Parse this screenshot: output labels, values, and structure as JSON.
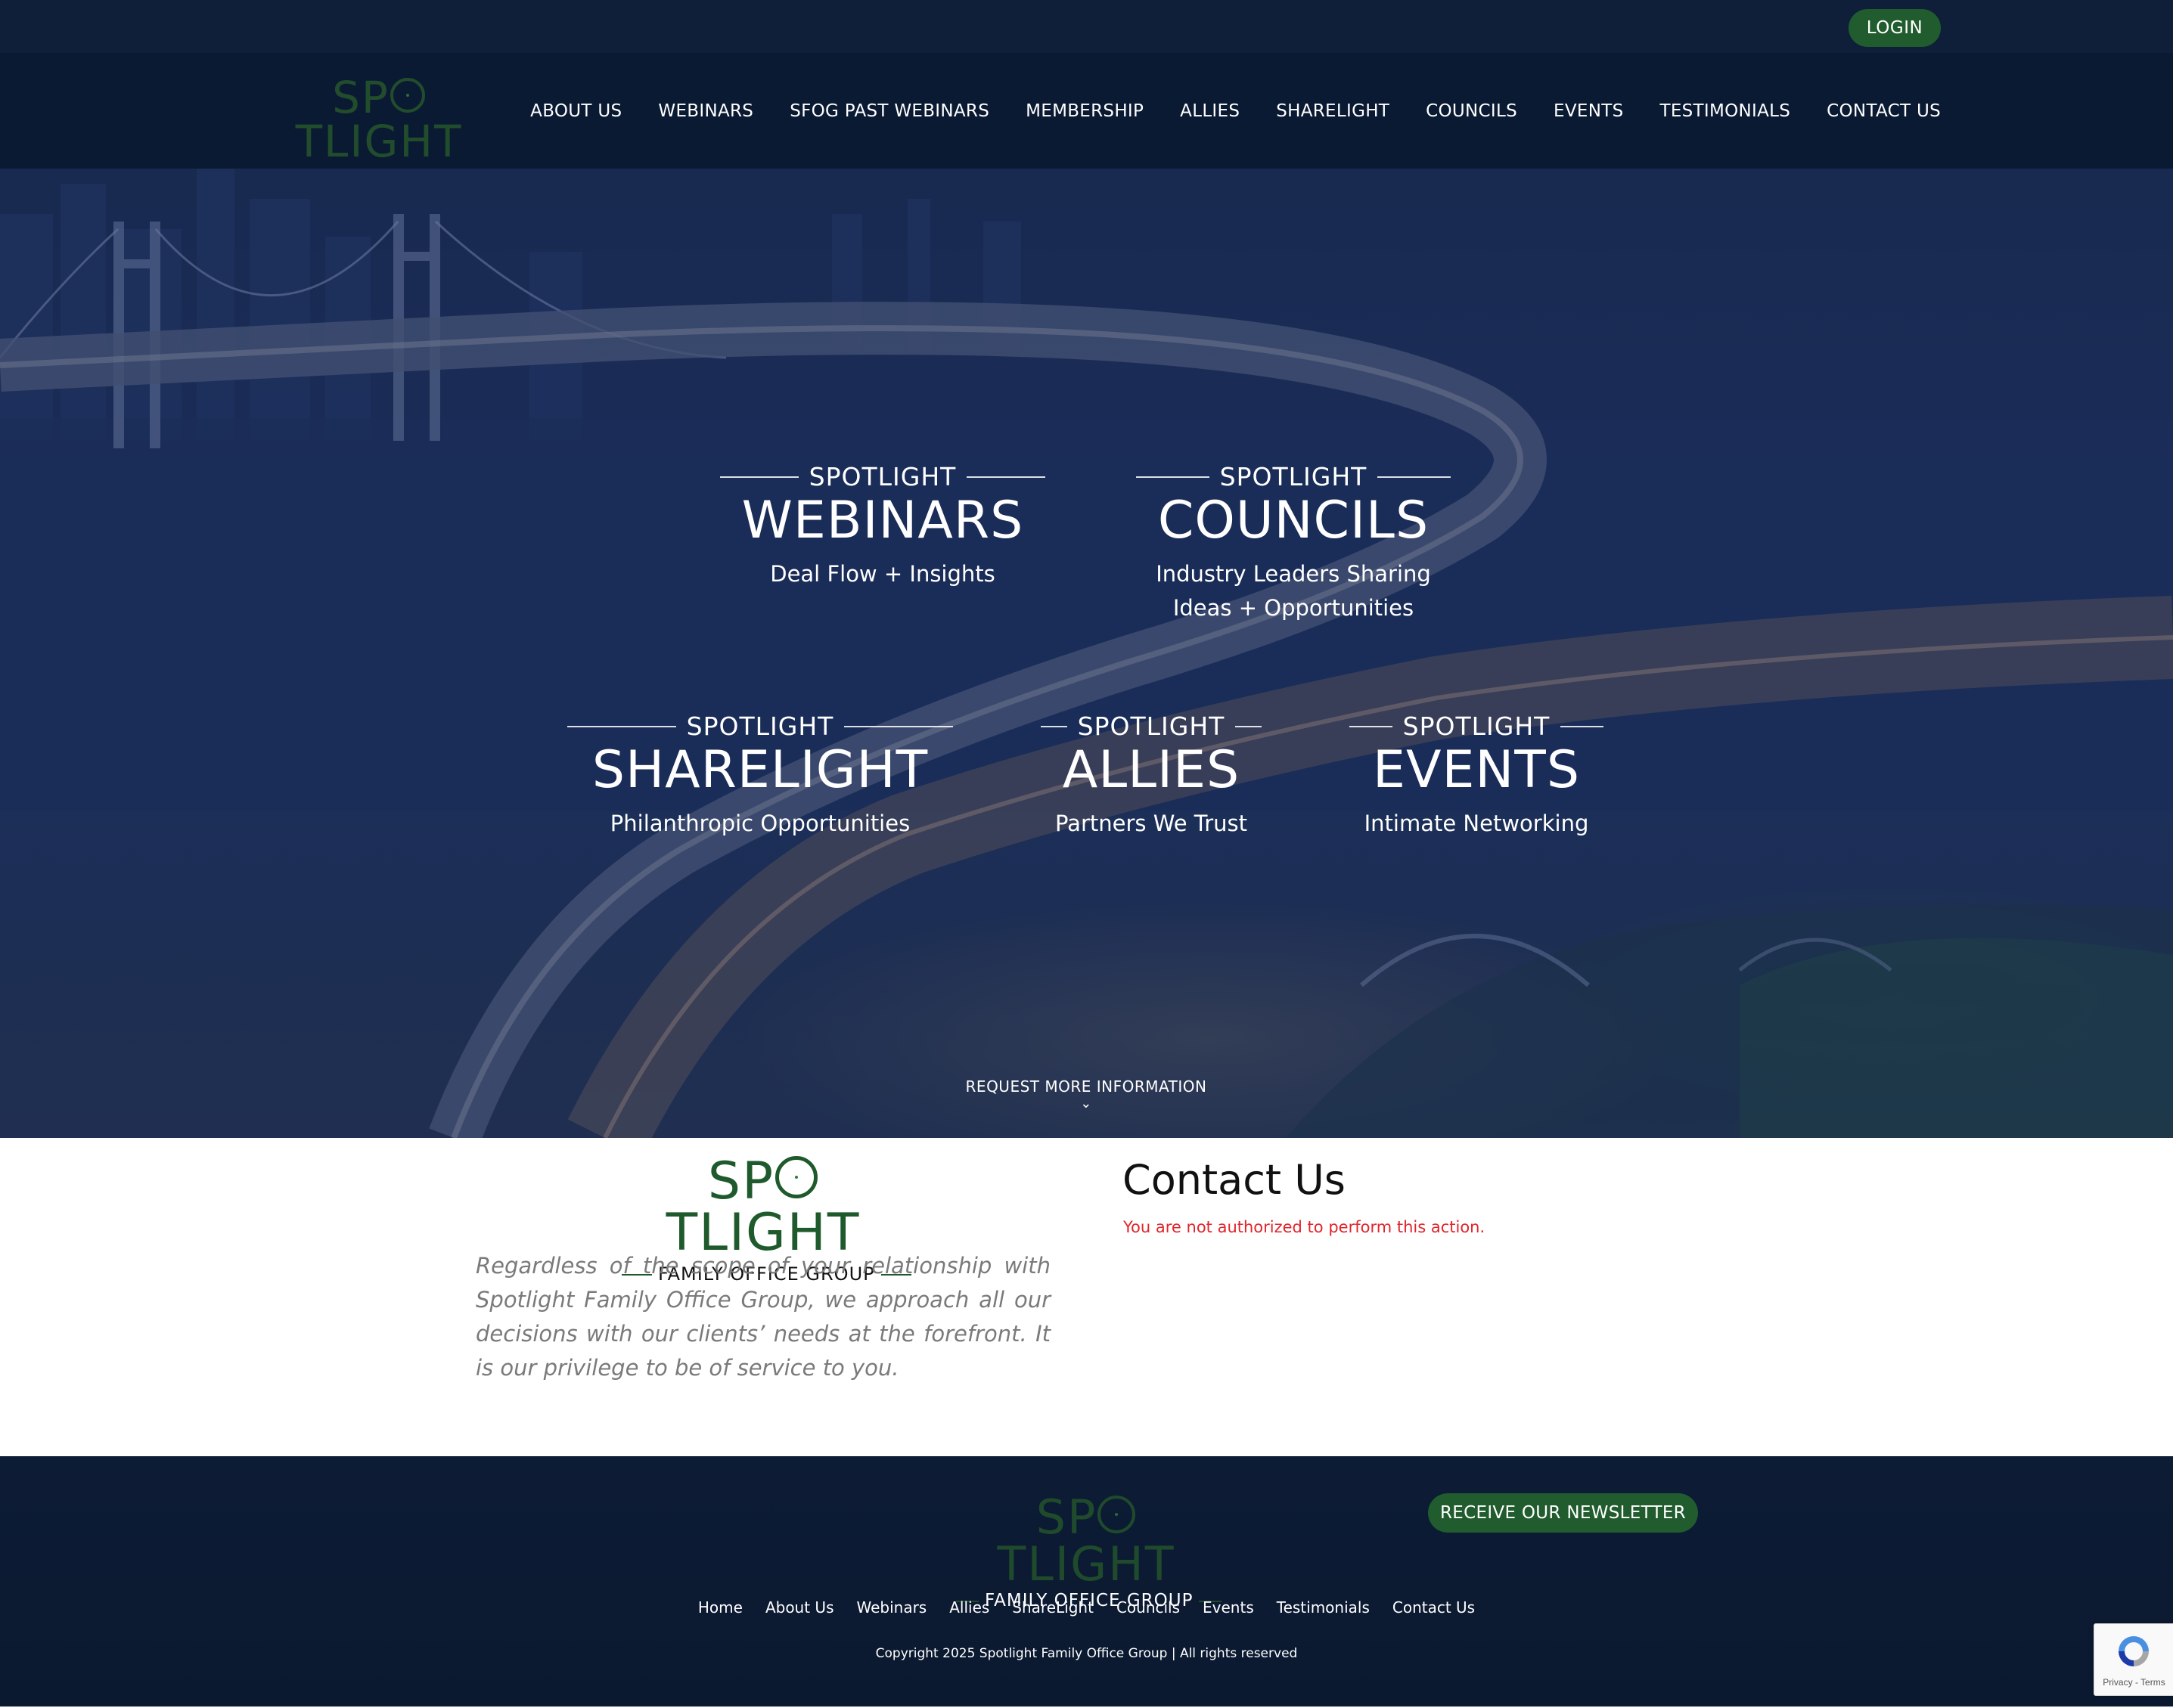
{
  "topbar": {
    "login_label": "LOGIN"
  },
  "brand": {
    "logo_word_left": "SP",
    "logo_word_right": "TLIGHT",
    "logo_sub": "FAMILY OFFICE GROUP",
    "accent_green": "#215c2e",
    "navy": "#0b1a33"
  },
  "nav": {
    "items": [
      {
        "label": "ABOUT US"
      },
      {
        "label": "WEBINARS"
      },
      {
        "label": "SFOG PAST WEBINARS"
      },
      {
        "label": "MEMBERSHIP"
      },
      {
        "label": "ALLIES"
      },
      {
        "label": "SHARELIGHT"
      },
      {
        "label": "COUNCILS"
      },
      {
        "label": "EVENTS"
      },
      {
        "label": "TESTIMONIALS"
      },
      {
        "label": "CONTACT US"
      }
    ]
  },
  "hero": {
    "features": [
      {
        "kicker": "SPOTLIGHT",
        "title": "WEBINARS",
        "desc": "Deal Flow + Insights"
      },
      {
        "kicker": "SPOTLIGHT",
        "title": "COUNCILS",
        "desc_line1": "Industry Leaders Sharing",
        "desc_line2": "Ideas + Opportunities"
      },
      {
        "kicker": "SPOTLIGHT",
        "title": "SHARELIGHT",
        "desc": "Philanthropic Opportunities"
      },
      {
        "kicker": "SPOTLIGHT",
        "title": "ALLIES",
        "desc": "Partners We Trust"
      },
      {
        "kicker": "SPOTLIGHT",
        "title": "EVENTS",
        "desc": "Intimate Networking"
      }
    ],
    "request_label": "REQUEST MORE INFORMATION",
    "request_icon": "chevron-down-icon"
  },
  "info": {
    "quote": "Regardless of the scope of your relationship with Spotlight Family Office Group, we approach all our decisions with our clients’ needs at the forefront. It is our privilege to be of service to you.",
    "contact_title": "Contact Us",
    "contact_error": "You are not authorized to perform this action.",
    "error_color": "#e0252b"
  },
  "footer": {
    "newsletter_label": "RECEIVE OUR NEWSLETTER",
    "links": [
      {
        "label": "Home"
      },
      {
        "label": "About Us"
      },
      {
        "label": "Webinars"
      },
      {
        "label": "Allies"
      },
      {
        "label": "ShareLight"
      },
      {
        "label": "Councils"
      },
      {
        "label": "Events"
      },
      {
        "label": "Testimonials"
      },
      {
        "label": "Contact Us"
      }
    ],
    "copyright": "Copyright 2025 Spotlight Family Office Group | All rights reserved"
  },
  "recaptcha": {
    "terms": "Privacy - Terms",
    "icon": "recaptcha-icon"
  }
}
